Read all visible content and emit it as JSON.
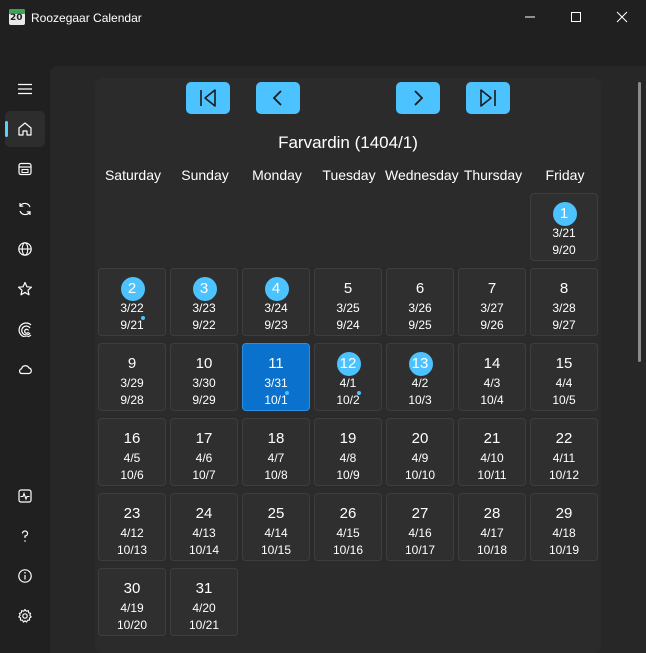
{
  "window": {
    "title": "Roozegaar Calendar",
    "icon_number": "20",
    "controls": [
      "minimize-icon",
      "maximize-icon",
      "close-icon"
    ]
  },
  "sidebar": {
    "top_items": [
      {
        "name": "hamburger-menu",
        "icon": "hamburger-icon"
      },
      {
        "name": "home",
        "icon": "home-icon",
        "active": true
      },
      {
        "name": "calendar",
        "icon": "calendar-icon"
      },
      {
        "name": "sync",
        "icon": "sync-icon"
      },
      {
        "name": "world",
        "icon": "globe-icon"
      },
      {
        "name": "favorites",
        "icon": "star-icon"
      },
      {
        "name": "converter",
        "icon": "rainbow-icon"
      },
      {
        "name": "cloud",
        "icon": "cloud-icon"
      }
    ],
    "bottom_items": [
      {
        "name": "activity",
        "icon": "activity-icon"
      },
      {
        "name": "help",
        "icon": "help-icon"
      },
      {
        "name": "info",
        "icon": "info-icon"
      },
      {
        "name": "settings",
        "icon": "gear-icon"
      }
    ]
  },
  "calendar": {
    "nav_buttons": [
      "first-month",
      "previous-month",
      "next-month",
      "last-month"
    ],
    "title": "Farvardin (1404/1)",
    "weekdays": [
      "Saturday",
      "Sunday",
      "Monday",
      "Tuesday",
      "Wednesday",
      "Thursday",
      "Friday"
    ],
    "days": [
      {
        "day": "1",
        "greg": "3/21",
        "hijri": "9/20",
        "col": 6,
        "row": 0,
        "holiday": true
      },
      {
        "day": "2",
        "greg": "3/22",
        "hijri": "9/21",
        "col": 0,
        "row": 1,
        "holiday": true,
        "dot": true
      },
      {
        "day": "3",
        "greg": "3/23",
        "hijri": "9/22",
        "col": 1,
        "row": 1,
        "holiday": true
      },
      {
        "day": "4",
        "greg": "3/24",
        "hijri": "9/23",
        "col": 2,
        "row": 1,
        "holiday": true
      },
      {
        "day": "5",
        "greg": "3/25",
        "hijri": "9/24",
        "col": 3,
        "row": 1
      },
      {
        "day": "6",
        "greg": "3/26",
        "hijri": "9/25",
        "col": 4,
        "row": 1
      },
      {
        "day": "7",
        "greg": "3/27",
        "hijri": "9/26",
        "col": 5,
        "row": 1
      },
      {
        "day": "8",
        "greg": "3/28",
        "hijri": "9/27",
        "col": 6,
        "row": 1
      },
      {
        "day": "9",
        "greg": "3/29",
        "hijri": "9/28",
        "col": 0,
        "row": 2
      },
      {
        "day": "10",
        "greg": "3/30",
        "hijri": "9/29",
        "col": 1,
        "row": 2
      },
      {
        "day": "11",
        "greg": "3/31",
        "hijri": "10/1",
        "col": 2,
        "row": 2,
        "today": true,
        "dot": true
      },
      {
        "day": "12",
        "greg": "4/1",
        "hijri": "10/2",
        "col": 3,
        "row": 2,
        "holiday": true,
        "dot": true
      },
      {
        "day": "13",
        "greg": "4/2",
        "hijri": "10/3",
        "col": 4,
        "row": 2,
        "holiday": true
      },
      {
        "day": "14",
        "greg": "4/3",
        "hijri": "10/4",
        "col": 5,
        "row": 2
      },
      {
        "day": "15",
        "greg": "4/4",
        "hijri": "10/5",
        "col": 6,
        "row": 2
      },
      {
        "day": "16",
        "greg": "4/5",
        "hijri": "10/6",
        "col": 0,
        "row": 3
      },
      {
        "day": "17",
        "greg": "4/6",
        "hijri": "10/7",
        "col": 1,
        "row": 3
      },
      {
        "day": "18",
        "greg": "4/7",
        "hijri": "10/8",
        "col": 2,
        "row": 3
      },
      {
        "day": "19",
        "greg": "4/8",
        "hijri": "10/9",
        "col": 3,
        "row": 3
      },
      {
        "day": "20",
        "greg": "4/9",
        "hijri": "10/10",
        "col": 4,
        "row": 3
      },
      {
        "day": "21",
        "greg": "4/10",
        "hijri": "10/11",
        "col": 5,
        "row": 3
      },
      {
        "day": "22",
        "greg": "4/11",
        "hijri": "10/12",
        "col": 6,
        "row": 3
      },
      {
        "day": "23",
        "greg": "4/12",
        "hijri": "10/13",
        "col": 0,
        "row": 4
      },
      {
        "day": "24",
        "greg": "4/13",
        "hijri": "10/14",
        "col": 1,
        "row": 4
      },
      {
        "day": "25",
        "greg": "4/14",
        "hijri": "10/15",
        "col": 2,
        "row": 4
      },
      {
        "day": "26",
        "greg": "4/15",
        "hijri": "10/16",
        "col": 3,
        "row": 4
      },
      {
        "day": "27",
        "greg": "4/16",
        "hijri": "10/17",
        "col": 4,
        "row": 4
      },
      {
        "day": "28",
        "greg": "4/17",
        "hijri": "10/18",
        "col": 5,
        "row": 4
      },
      {
        "day": "29",
        "greg": "4/18",
        "hijri": "10/19",
        "col": 6,
        "row": 4
      },
      {
        "day": "30",
        "greg": "4/19",
        "hijri": "10/20",
        "col": 0,
        "row": 5
      },
      {
        "day": "31",
        "greg": "4/20",
        "hijri": "10/21",
        "col": 1,
        "row": 5
      }
    ]
  },
  "colors": {
    "accent": "#4cc2ff",
    "today": "#0a72cc",
    "background": "#202020",
    "card": "#2b2b2b",
    "day_cell": "#2f2f2f"
  }
}
